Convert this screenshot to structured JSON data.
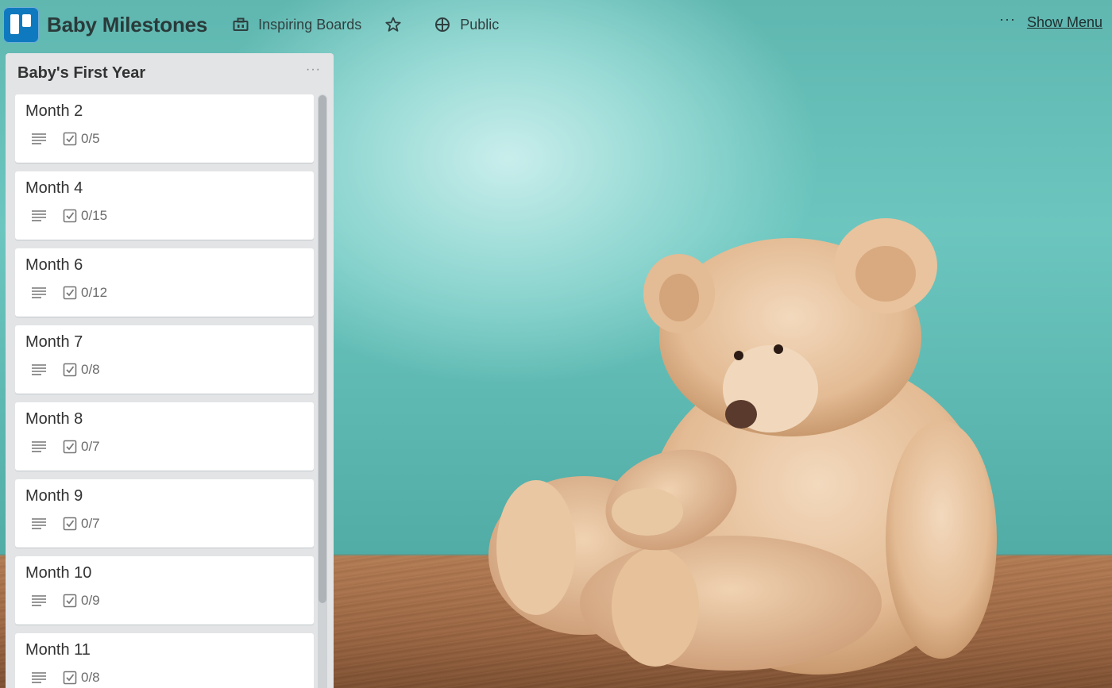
{
  "board": {
    "title": "Baby Milestones",
    "team_label": "Inspiring Boards",
    "visibility_label": "Public",
    "more_label": "···",
    "show_menu_label": "Show Menu"
  },
  "list": {
    "title": "Baby's First Year",
    "menu_label": "···",
    "cards": [
      {
        "title": "Month 2",
        "checklist": "0/5"
      },
      {
        "title": "Month 4",
        "checklist": "0/15"
      },
      {
        "title": "Month 6",
        "checklist": "0/12"
      },
      {
        "title": "Month 7",
        "checklist": "0/8"
      },
      {
        "title": "Month 8",
        "checklist": "0/7"
      },
      {
        "title": "Month 9",
        "checklist": "0/7"
      },
      {
        "title": "Month 10",
        "checklist": "0/9"
      },
      {
        "title": "Month 11",
        "checklist": "0/8"
      }
    ]
  },
  "icons": {
    "logo": "trello-logo-icon",
    "team": "briefcase-icon",
    "star": "star-icon",
    "visibility": "globe-icon",
    "description": "description-lines-icon",
    "checklist": "checkbox-icon"
  },
  "colors": {
    "logo_blue": "#0f79bf",
    "list_bg": "#e2e4e6",
    "card_bg": "#ffffff"
  }
}
